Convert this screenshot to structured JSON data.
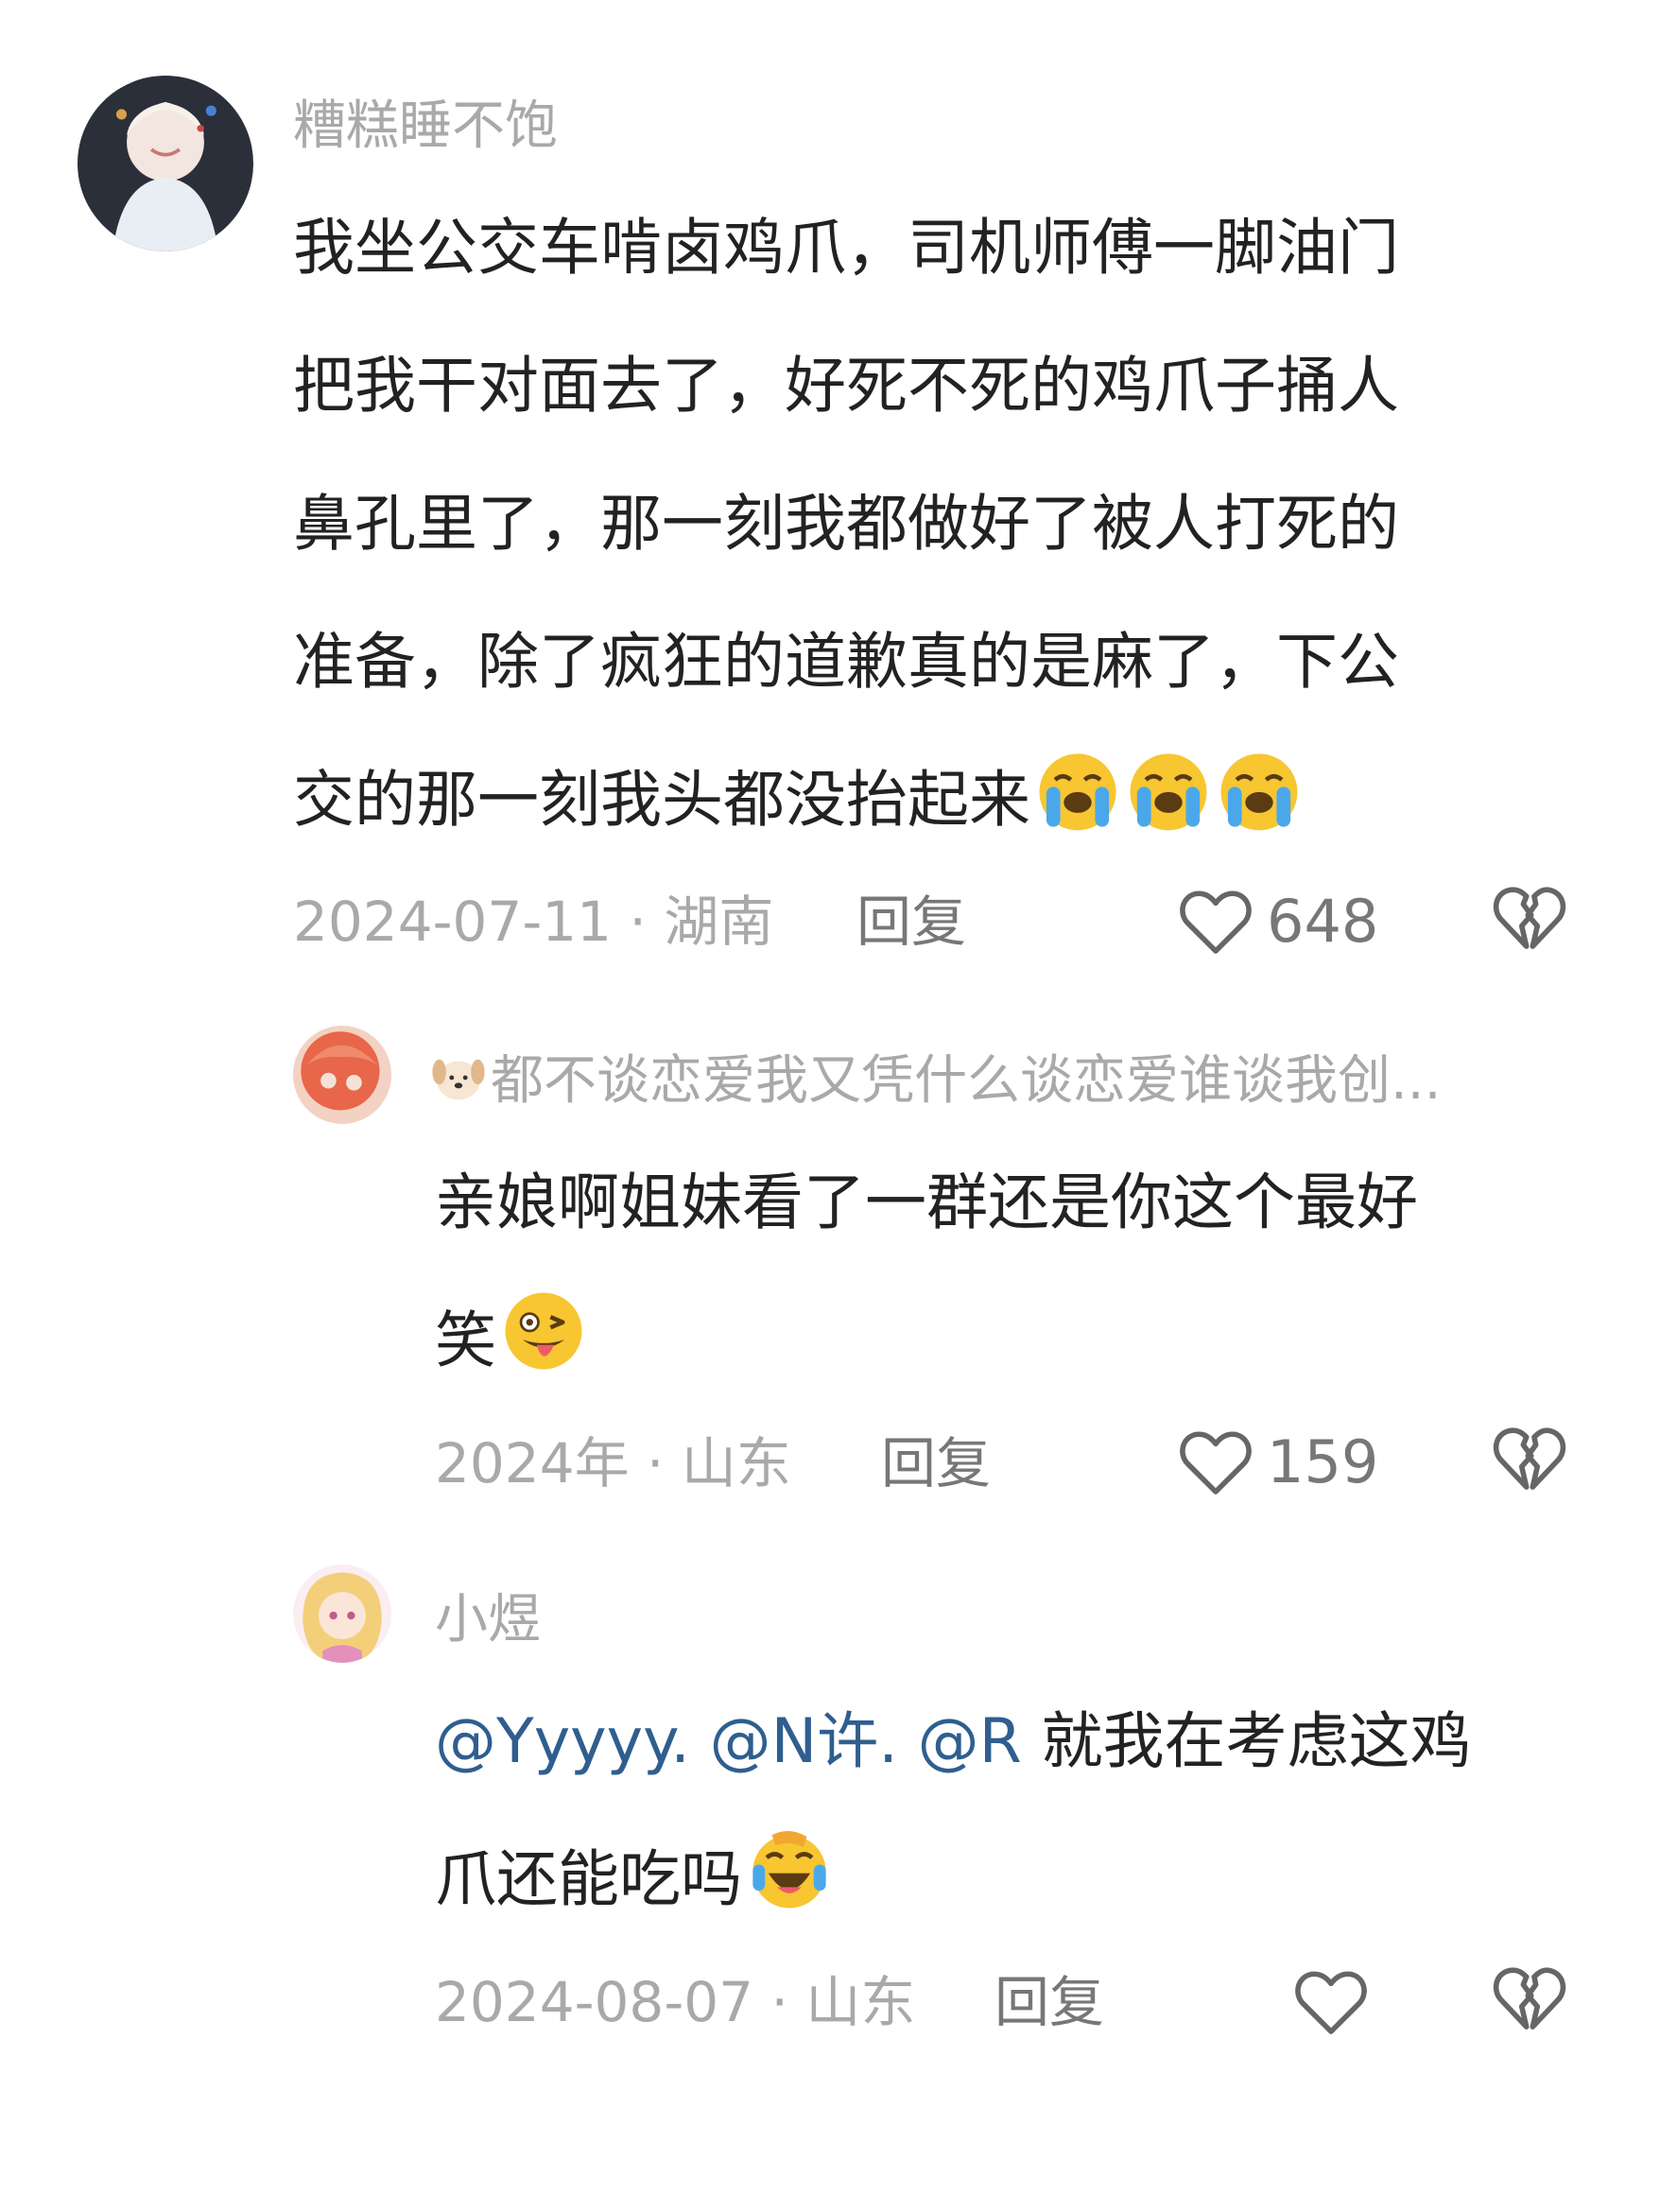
{
  "comments": [
    {
      "username": "糟糕睡不饱",
      "lines": [
        "我坐公交车啃卤鸡爪，司机师傅一脚油门",
        "把我干对面去了，好死不死的鸡爪子捅人",
        "鼻孔里了，那一刻我都做好了被人打死的",
        "准备，除了疯狂的道歉真的是麻了，下公",
        "交的那一刻我头都没抬起来"
      ],
      "emojis": [
        "loudly-crying-face",
        "loudly-crying-face",
        "loudly-crying-face"
      ],
      "date": "2024-07-11 · 湖南",
      "reply_label": "回复",
      "likes": "648"
    },
    {
      "username": "都不谈恋爱我又凭什么谈恋爱谁谈我创...",
      "username_emoji": "dog-face",
      "lines": [
        "亲娘啊姐妹看了一群还是你这个最好",
        "笑"
      ],
      "emojis": [
        "winking-face-with-tongue"
      ],
      "date": "2024年 · 山东",
      "reply_label": "回复",
      "likes": "159"
    },
    {
      "username": "小煜",
      "mentions": [
        "@Yyyyy.",
        "@N许.",
        "@R"
      ],
      "lines": [
        "就我在考虑这鸡",
        "爪还能吃吗"
      ],
      "emojis": [
        "rolling-laughing-face"
      ],
      "date": "2024-08-07 · 山东",
      "reply_label": "回复",
      "likes": ""
    }
  ],
  "colors": {
    "text": "#222222",
    "meta": "#a9a9a9",
    "mention": "#2f5e8f",
    "icon": "#666666"
  }
}
